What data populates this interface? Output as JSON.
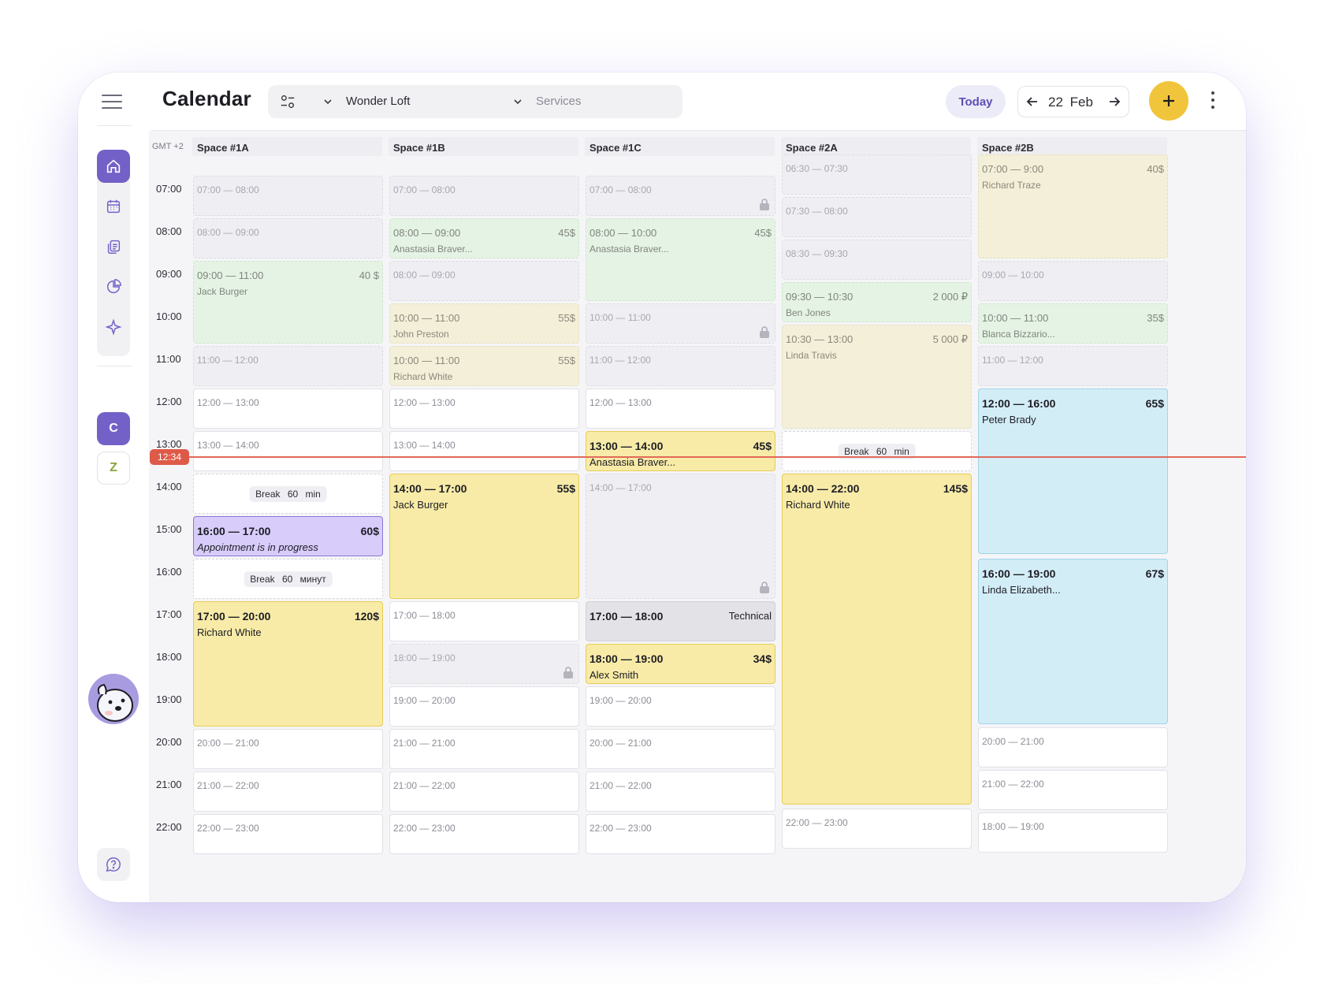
{
  "app": {
    "title": "Calendar"
  },
  "filters": {
    "location": "Wonder Loft",
    "services_placeholder": "Services"
  },
  "nav": {
    "today_label": "Today",
    "date_label": "22 Feb"
  },
  "sidebar": {
    "icons": [
      "home-icon",
      "calendar-icon",
      "documents-icon",
      "analytics-icon",
      "sparkle-icon"
    ],
    "workspaces": [
      {
        "letter": "C",
        "color": "#7361c7"
      },
      {
        "letter": "Z",
        "color": "#8aa23a"
      }
    ]
  },
  "timezone": "GMT +2",
  "hours": [
    "07:00",
    "08:00",
    "09:00",
    "10:00",
    "11:00",
    "12:00",
    "13:00",
    "14:00",
    "15:00",
    "16:00",
    "17:00",
    "18:00",
    "19:00",
    "20:00",
    "21:00",
    "22:00"
  ],
  "now_time": "12:34",
  "columns": [
    {
      "name": "Space #1A",
      "slots": [
        {
          "type": "free",
          "time": "07:00 — 08:00"
        },
        {
          "type": "free",
          "time": "08:00 — 09:00"
        },
        {
          "type": "green",
          "time": "09:00 — 11:00",
          "price": "40 $",
          "name": "Jack Burger"
        },
        {
          "type": "free",
          "time": "11:00 — 12:00"
        },
        {
          "type": "open",
          "time": "12:00 — 13:00"
        },
        {
          "type": "open",
          "time": "13:00 — 14:00"
        },
        {
          "type": "brk",
          "label": "Break 60 min"
        },
        {
          "type": "ev-p",
          "time": "16:00 — 17:00",
          "price": "60$",
          "name": "Appointment is in progress"
        },
        {
          "type": "brk",
          "label": "Break 60 минут"
        },
        {
          "type": "ev-y",
          "time": "17:00 — 20:00",
          "price": "120$",
          "name": "Richard White"
        },
        {
          "type": "open",
          "time": "20:00 — 21:00"
        },
        {
          "type": "open",
          "time": "21:00 — 22:00"
        },
        {
          "type": "open",
          "time": "22:00 — 23:00"
        }
      ]
    },
    {
      "name": "Space #1B",
      "slots": [
        {
          "type": "free",
          "time": "07:00 — 08:00"
        },
        {
          "type": "green",
          "time": "08:00 — 09:00",
          "price": "45$",
          "name": "Anastasia Braver..."
        },
        {
          "type": "free",
          "time": "08:00 — 09:00"
        },
        {
          "type": "cream",
          "time": "10:00 — 11:00",
          "price": "55$",
          "name": "John Preston"
        },
        {
          "type": "cream",
          "time": "10:00 — 11:00",
          "price": "55$",
          "name": "Richard White"
        },
        {
          "type": "open",
          "time": "12:00 — 13:00"
        },
        {
          "type": "open",
          "time": "13:00 — 14:00"
        },
        {
          "type": "ev-y",
          "time": "14:00 — 17:00",
          "price": "55$",
          "name": "Jack Burger"
        },
        {
          "type": "open",
          "time": "17:00 — 18:00"
        },
        {
          "type": "free",
          "time": "18:00 — 19:00",
          "locked": true
        },
        {
          "type": "open",
          "time": "19:00 — 20:00"
        },
        {
          "type": "open",
          "time": "21:00 — 21:00"
        },
        {
          "type": "open",
          "time": "21:00 — 22:00"
        },
        {
          "type": "open",
          "time": "22:00 — 23:00"
        }
      ]
    },
    {
      "name": "Space #1C",
      "slots": [
        {
          "type": "free",
          "time": "07:00 — 08:00",
          "locked": true
        },
        {
          "type": "green",
          "time": "08:00 — 10:00",
          "price": "45$",
          "name": "Anastasia Braver..."
        },
        {
          "type": "free",
          "time": "10:00 — 11:00",
          "locked": true
        },
        {
          "type": "free",
          "time": "11:00 — 12:00"
        },
        {
          "type": "open",
          "time": "12:00 — 13:00"
        },
        {
          "type": "ev-y",
          "time": "13:00 — 14:00",
          "price": "45$",
          "name": "Anastasia Braver..."
        },
        {
          "type": "free",
          "time": "14:00 — 17:00",
          "locked": true
        },
        {
          "type": "ev-g",
          "time": "17:00 — 18:00",
          "price": "Technical"
        },
        {
          "type": "ev-y",
          "time": "18:00 — 19:00",
          "price": "34$",
          "name": "Alex Smith"
        },
        {
          "type": "open",
          "time": "19:00 — 20:00"
        },
        {
          "type": "open",
          "time": "20:00 — 21:00"
        },
        {
          "type": "open",
          "time": "21:00 — 22:00"
        },
        {
          "type": "open",
          "time": "22:00 — 23:00"
        }
      ]
    },
    {
      "name": "Space #2A",
      "slots": [
        {
          "type": "free",
          "time": "06:30 — 07:30"
        },
        {
          "type": "free",
          "time": "07:30 — 08:00"
        },
        {
          "type": "free",
          "time": "08:30 — 09:30"
        },
        {
          "type": "green",
          "time": "09:30 — 10:30",
          "price": "2 000 ₽",
          "name": "Ben Jones"
        },
        {
          "type": "cream",
          "time": "10:30 — 13:00",
          "price": "5 000 ₽",
          "name": "Linda Travis"
        },
        {
          "type": "brk",
          "label": "Break 60 min"
        },
        {
          "type": "ev-y",
          "time": "14:00 — 22:00",
          "price": "145$",
          "name": "Richard White"
        },
        {
          "type": "open",
          "time": "22:00 — 23:00"
        }
      ]
    },
    {
      "name": "Space #2B",
      "slots": [
        {
          "type": "cream",
          "time": "07:00 — 9:00",
          "price": "40$",
          "name": "Richard Traze"
        },
        {
          "type": "free",
          "time": "09:00 — 10:00"
        },
        {
          "type": "green",
          "time": "10:00 — 11:00",
          "price": "35$",
          "name": "Blanca Bizzario..."
        },
        {
          "type": "free",
          "time": "11:00 — 12:00"
        },
        {
          "type": "ev-b",
          "time": "12:00 — 16:00",
          "price": "65$",
          "name": "Peter Brady"
        },
        {
          "type": "ev-b",
          "time": "16:00 — 19:00",
          "price": "67$",
          "name": "Linda Elizabeth..."
        },
        {
          "type": "open",
          "time": "20:00 — 21:00"
        },
        {
          "type": "open",
          "time": "21:00 — 22:00"
        },
        {
          "type": "open",
          "time": "18:00 — 19:00"
        }
      ]
    }
  ]
}
